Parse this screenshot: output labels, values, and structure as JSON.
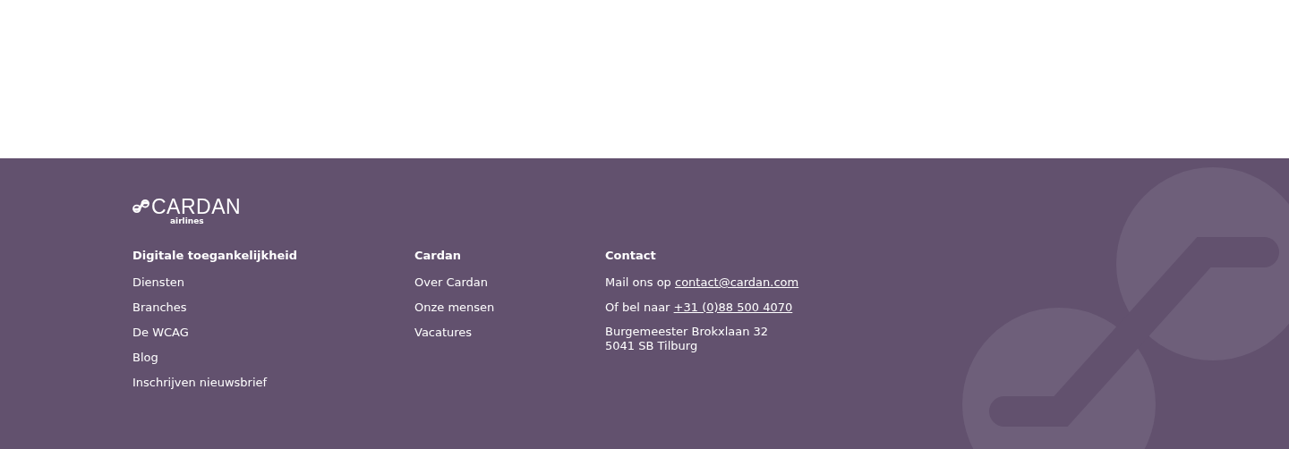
{
  "logo": {
    "name": "CARDAN",
    "sub": "airlines"
  },
  "columns": [
    {
      "heading": "Digitale toegankelijkheid",
      "items": [
        {
          "kind": "link",
          "text": "Diensten"
        },
        {
          "kind": "link",
          "text": "Branches"
        },
        {
          "kind": "link",
          "text": "De WCAG"
        },
        {
          "kind": "link",
          "text": "Blog"
        },
        {
          "kind": "link",
          "text": "Inschrijven nieuwsbrief"
        }
      ]
    },
    {
      "heading": "Cardan",
      "items": [
        {
          "kind": "link",
          "text": "Over Cardan"
        },
        {
          "kind": "link",
          "text": "Onze mensen"
        },
        {
          "kind": "link",
          "text": "Vacatures"
        }
      ]
    },
    {
      "heading": "Contact",
      "items": [
        {
          "kind": "inline_link",
          "text": "Mail ons op",
          "link": "contact@cardan.com"
        },
        {
          "kind": "inline_link",
          "text": "Of bel naar",
          "link": "+31 (0)88 500 4070"
        },
        {
          "kind": "address",
          "lines": [
            "Burgemeester Brokxlaan 32",
            "5041 SB Tilburg"
          ]
        }
      ]
    }
  ]
}
